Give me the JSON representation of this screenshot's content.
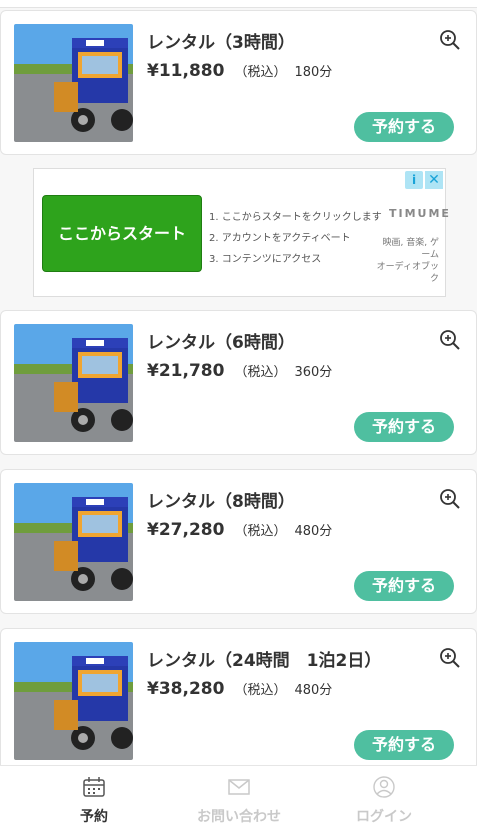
{
  "rentals": [
    {
      "title": "レンタル（3時間）",
      "price": "¥11,880",
      "tax": "（税込）",
      "minutes": "180分",
      "button": "予約する"
    },
    {
      "title": "レンタル（6時間）",
      "price": "¥21,780",
      "tax": "（税込）",
      "minutes": "360分",
      "button": "予約する"
    },
    {
      "title": "レンタル（8時間）",
      "price": "¥27,280",
      "tax": "（税込）",
      "minutes": "480分",
      "button": "予約する"
    },
    {
      "title": "レンタル（24時間　1泊2日）",
      "price": "¥38,280",
      "tax": "（税込）",
      "minutes": "480分",
      "button": "予約する"
    }
  ],
  "ad": {
    "cta": "ここからスタート",
    "steps": [
      "1. ここからスタートをクリックします",
      "2. アカウントをアクティベート",
      "3. コンテンツにアクセス"
    ],
    "brand": "TIMUME",
    "categories": [
      "映画, 音楽, ゲーム",
      "オーディオブック"
    ],
    "info_icon": "i",
    "close_icon": "✕"
  },
  "tabs": [
    {
      "label": "予約",
      "icon": "calendar-icon",
      "active": true
    },
    {
      "label": "お問い合わせ",
      "icon": "mail-icon",
      "active": false
    },
    {
      "label": "ログイン",
      "icon": "user-icon",
      "active": false
    }
  ],
  "colors": {
    "accent": "#4fbfa0",
    "ad_cta": "#2ea31c",
    "text": "#333333",
    "inactive": "#c9c9c9"
  }
}
